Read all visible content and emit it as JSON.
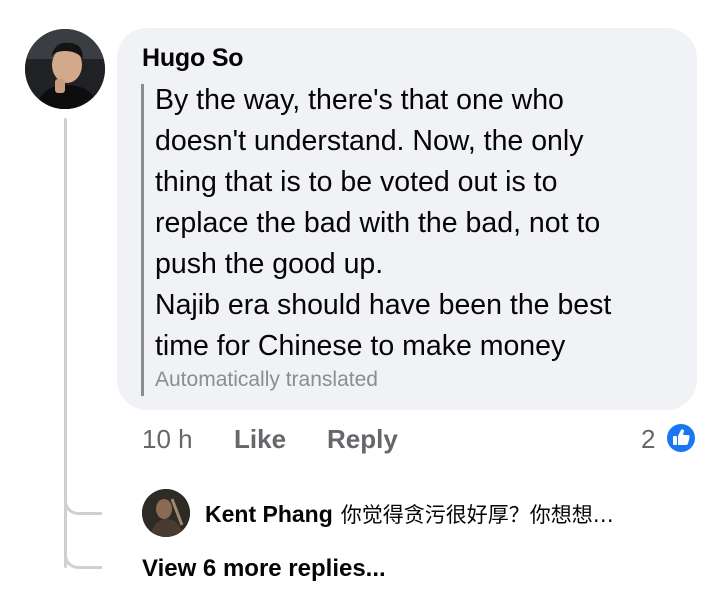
{
  "comment": {
    "author": "Hugo So",
    "text": "By the way, there's that one who\ndoesn't understand. Now, the only\nthing that is to be voted out is to\nreplace the bad with the bad, not to\npush the good up.\nNajib era should have been the best\ntime for Chinese to make money",
    "translation_note": "Automatically translated",
    "time": "10 h",
    "like_label": "Like",
    "reply_label": "Reply",
    "reaction_count": "2",
    "reaction_icon": "like-thumbs-up-icon",
    "accent_color": "#1877f2"
  },
  "reply_preview": {
    "author": "Kent Phang",
    "text": "你觉得贪污很好厚？你想想…"
  },
  "view_more_label": "View 6 more replies..."
}
